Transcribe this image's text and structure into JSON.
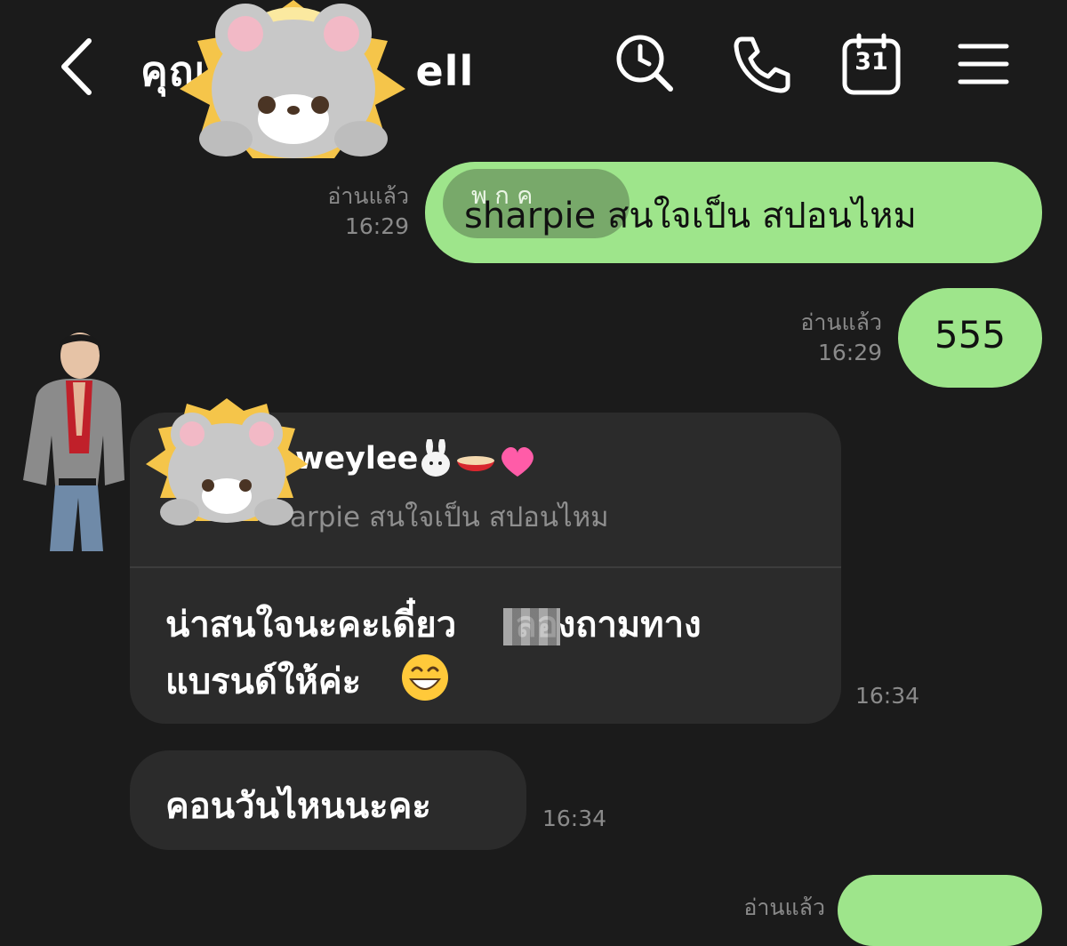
{
  "header": {
    "title": "คุณ",
    "title_suffix": "ell",
    "calendar_day": "31"
  },
  "messages": [
    {
      "mention": "พ ก ค",
      "text": "sharpie สนใจเป็น สปอนไหม",
      "read_label": "อ่านแล้ว",
      "time": "16:29"
    },
    {
      "text": "555",
      "read_label": "อ่านแล้ว",
      "time": "16:29"
    },
    {
      "quote_name": "weylee",
      "quote_text": "arpie สนใจเป็น สปอนไหม",
      "text_line1": "น่าสนใจนะคะเดี๋ยว",
      "text_line1_after": "ลองถามทาง",
      "text_line2": "แบรนด์ให้ค่ะ",
      "time": "16:34"
    },
    {
      "text": "คอนวันไหนนะคะ",
      "time": "16:34"
    },
    {
      "read_label": "อ่านแล้ว"
    }
  ],
  "icons": {
    "back": "chevron-left-icon",
    "search": "clock-search-icon",
    "phone": "phone-icon",
    "calendar": "calendar-icon",
    "menu": "hamburger-menu-icon"
  },
  "colors": {
    "background": "#1b1b1b",
    "outgoing_bubble": "#9ee58b",
    "incoming_bubble": "#2b2b2b",
    "meta_text": "#8a8a8a"
  }
}
